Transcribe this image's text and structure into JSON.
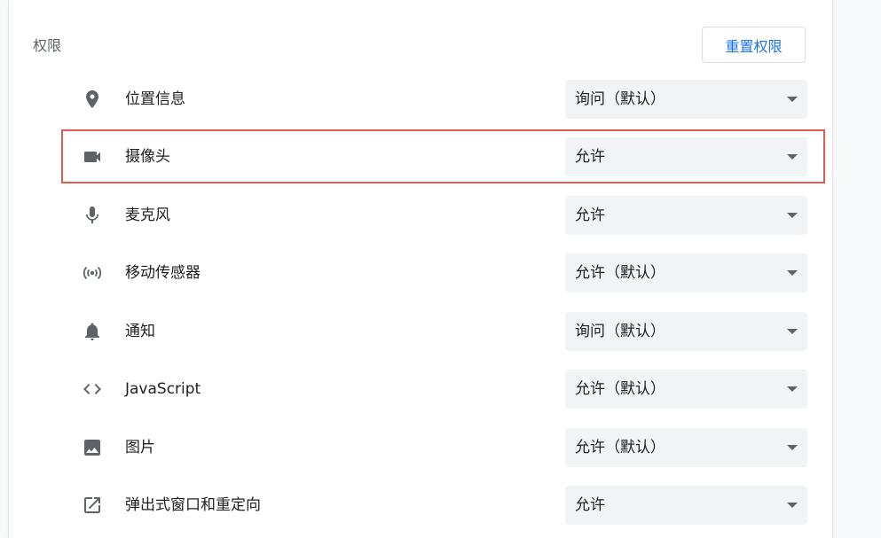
{
  "section": {
    "title": "权限",
    "reset_label": "重置权限"
  },
  "permissions": [
    {
      "icon": "location-pin-icon",
      "label": "位置信息",
      "value": "询问（默认）"
    },
    {
      "icon": "camera-icon",
      "label": "摄像头",
      "value": "允许"
    },
    {
      "icon": "microphone-icon",
      "label": "麦克风",
      "value": "允许"
    },
    {
      "icon": "motion-sensor-icon",
      "label": "移动传感器",
      "value": "允许（默认）"
    },
    {
      "icon": "bell-icon",
      "label": "通知",
      "value": "询问（默认）"
    },
    {
      "icon": "code-icon",
      "label": "JavaScript",
      "value": "允许（默认）"
    },
    {
      "icon": "image-icon",
      "label": "图片",
      "value": "允许（默认）"
    },
    {
      "icon": "open-in-new-icon",
      "label": "弹出式窗口和重定向",
      "value": "允许"
    }
  ],
  "highlight": {
    "color": "#e05a52",
    "target": "摄像头"
  },
  "colors": {
    "accent": "#1a73e8",
    "select_bg": "#f1f3f4",
    "icon": "#5f6368"
  }
}
